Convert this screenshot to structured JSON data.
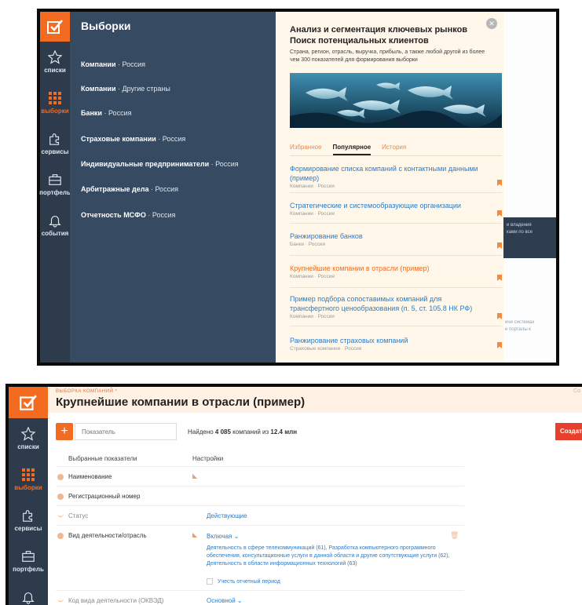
{
  "rail": {
    "items": [
      {
        "label": "списки",
        "icon": "star-icon"
      },
      {
        "label": "выборки",
        "icon": "grid-icon"
      },
      {
        "label": "сервисы",
        "icon": "puzzle-icon"
      },
      {
        "label": "портфель",
        "icon": "briefcase-icon"
      },
      {
        "label": "события",
        "icon": "bell-icon"
      }
    ]
  },
  "shot1": {
    "menu": {
      "title": "Выборки",
      "items": [
        {
          "main": "Компании",
          "sub": " · Россия"
        },
        {
          "main": "Компании",
          "sub": " · Другие страны"
        },
        {
          "main": "Банки",
          "sub": " · Россия"
        },
        {
          "main": "Страховые компании",
          "sub": " · Россия"
        },
        {
          "main": "Индивидуальные предприниматели",
          "sub": " · Россия"
        },
        {
          "main": "Арбитражные дела",
          "sub": " · Россия"
        },
        {
          "main": "Отчетность МСФО",
          "sub": " · Россия"
        }
      ]
    },
    "panel": {
      "title_line1": "Анализ и сегментация ключевых рынков",
      "title_line2": "Поиск потенциальных клиентов",
      "description": "Страна, регион, отрасль, выручка, прибыль, а также любой другой из более чем 300 показателей для формирования выборки",
      "tabs": [
        "Избранное",
        "Популярное",
        "История"
      ],
      "active_tab": "Популярное",
      "list": [
        {
          "title": "Формирование списка компаний с контактными данными (пример)",
          "sub": "Компании · Россия"
        },
        {
          "title": "Стратегические и системообразующие организации",
          "sub": "Компании · Россия"
        },
        {
          "title": "Ранжирование банков",
          "sub": "Банки · Россия"
        },
        {
          "title": "Крупнейшие компании в отрасли (пример)",
          "sub": "Компании · Россия"
        },
        {
          "title": "Пример подбора сопоставимых компаний для трансфертного ценообразования (п. 5, ст. 105.8 НК РФ)",
          "sub": "Компании · Россия"
        },
        {
          "title": "Ранжирование страховых компаний",
          "sub": "Страховые компании · Россия"
        }
      ]
    },
    "right_edge": {
      "dark_text_1": "и владения",
      "dark_text_2": "ками по все",
      "text_1": "ичи системах",
      "text_2": "е порталы к"
    }
  },
  "shot2": {
    "breadcrumb": "ВЫБОРКА КОМПАНИЙ *",
    "title": "Крупнейшие компании в отрасли (пример)",
    "corner_text": "Со",
    "search_placeholder": "Показатель",
    "found_prefix": "Найдено ",
    "found_count": "4 085",
    "found_mid": " компаний из ",
    "found_total": "12.4 млн",
    "create_label": "Создать",
    "col_selected": "Выбранные показатели",
    "col_settings": "Настройки",
    "rows": [
      {
        "label": "Наименование"
      },
      {
        "label": "Регистрационный номер"
      },
      {
        "label": "Статус",
        "setting": "Действующие"
      },
      {
        "label": "Вид деятельности/отрасль",
        "setting": "Включая ⌄",
        "detail": "Деятельность в сфере телекоммуникаций (61), Разработка компьютерного программного обеспечения, консультационные услуги в данной области и другие сопутствующие услуги (62), Деятельность в области информационных технологий (63)",
        "checkbox": "Учесть отчетный период"
      },
      {
        "label": "Код вида деятельности (ОКВЭД)",
        "setting": "Основной ⌄"
      }
    ]
  }
}
